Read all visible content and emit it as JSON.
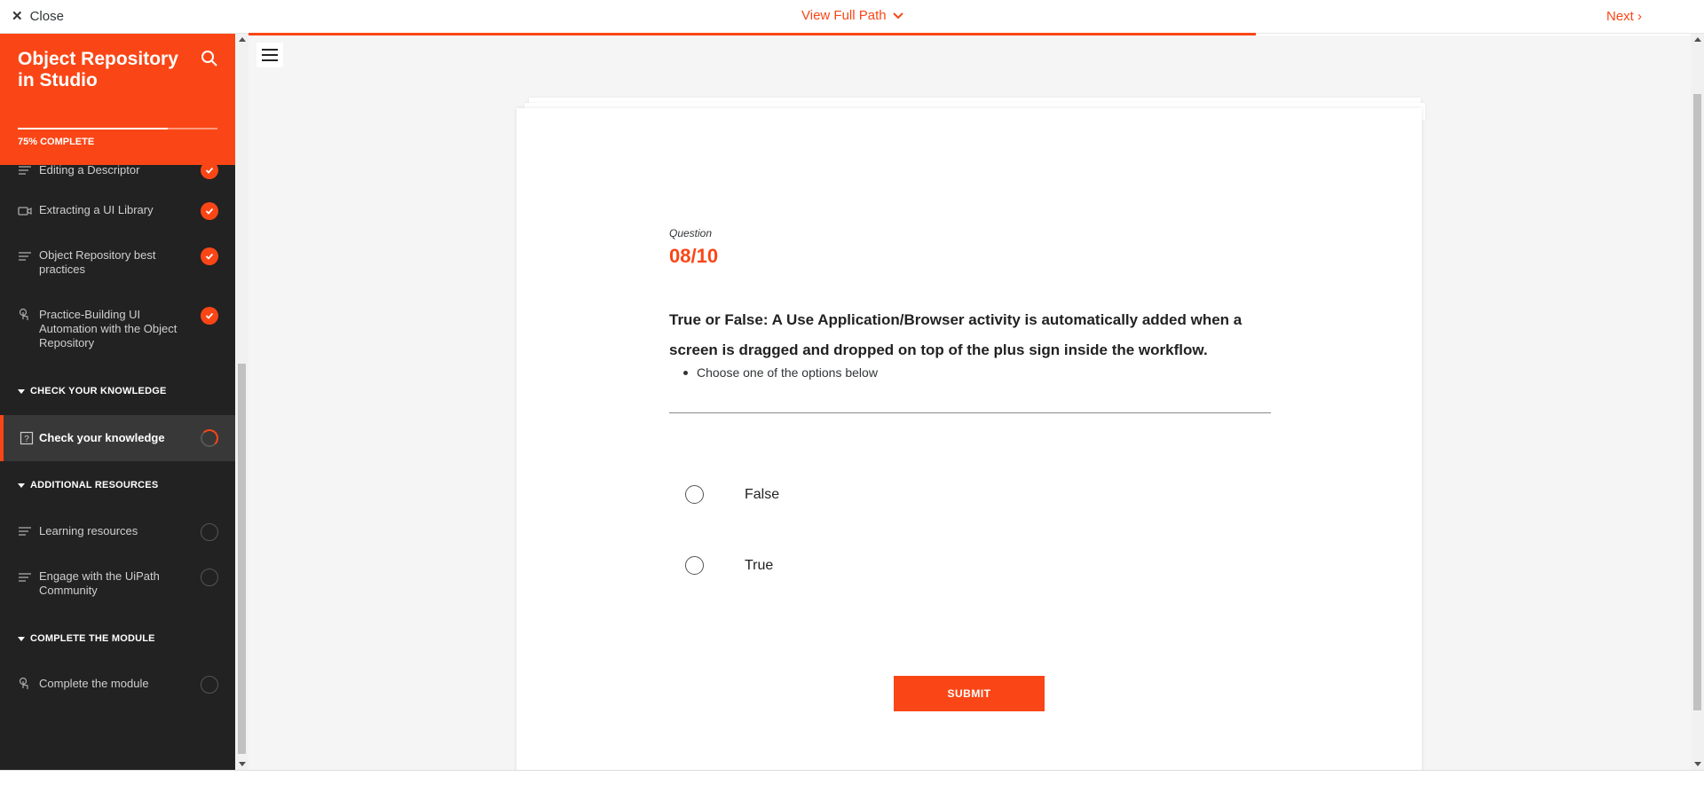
{
  "topbar": {
    "close_label": "Close",
    "view_path_label": "View Full Path",
    "next_label": "Next ›"
  },
  "sidebar": {
    "title": "Object Repository in Studio",
    "progress_percent": 75,
    "progress_text": "75% COMPLETE",
    "lessons_top": [
      {
        "label": "Editing a Descriptor",
        "icon": "text-lines-icon",
        "status": "complete"
      },
      {
        "label": "Extracting a UI Library",
        "icon": "video-icon",
        "status": "complete"
      },
      {
        "label": "Object Repository best practices",
        "icon": "text-lines-icon",
        "status": "complete"
      },
      {
        "label": "Practice-Building UI Automation with the Object Repository",
        "icon": "touch-icon",
        "status": "complete"
      }
    ],
    "sections": [
      {
        "label": "CHECK YOUR KNOWLEDGE"
      },
      {
        "label": "ADDITIONAL RESOURCES"
      },
      {
        "label": "COMPLETE THE MODULE"
      }
    ],
    "active_lesson": {
      "label": "Check your knowledge",
      "icon": "quiz-icon",
      "status": "in-progress"
    },
    "resources": [
      {
        "label": "Learning resources",
        "icon": "text-lines-icon",
        "status": "not-started"
      },
      {
        "label": "Engage with the UiPath Community",
        "icon": "text-lines-icon",
        "status": "not-started"
      }
    ],
    "complete_module": {
      "label": "Complete the module",
      "icon": "touch-icon",
      "status": "not-started"
    }
  },
  "quiz": {
    "question_label": "Question",
    "question_number": "08/10",
    "question_text": "True or False:  A Use Application/Browser activity is automatically added when a screen is dragged and dropped on top of the plus sign inside the workflow.",
    "hint": "Choose one of the options below",
    "choices": [
      {
        "label": "False",
        "selected": false
      },
      {
        "label": "True",
        "selected": false
      }
    ],
    "submit_label": "SUBMIT"
  },
  "colors": {
    "accent": "#fa4616",
    "sidebar_bg": "#222222",
    "main_bg": "#f5f5f5"
  }
}
